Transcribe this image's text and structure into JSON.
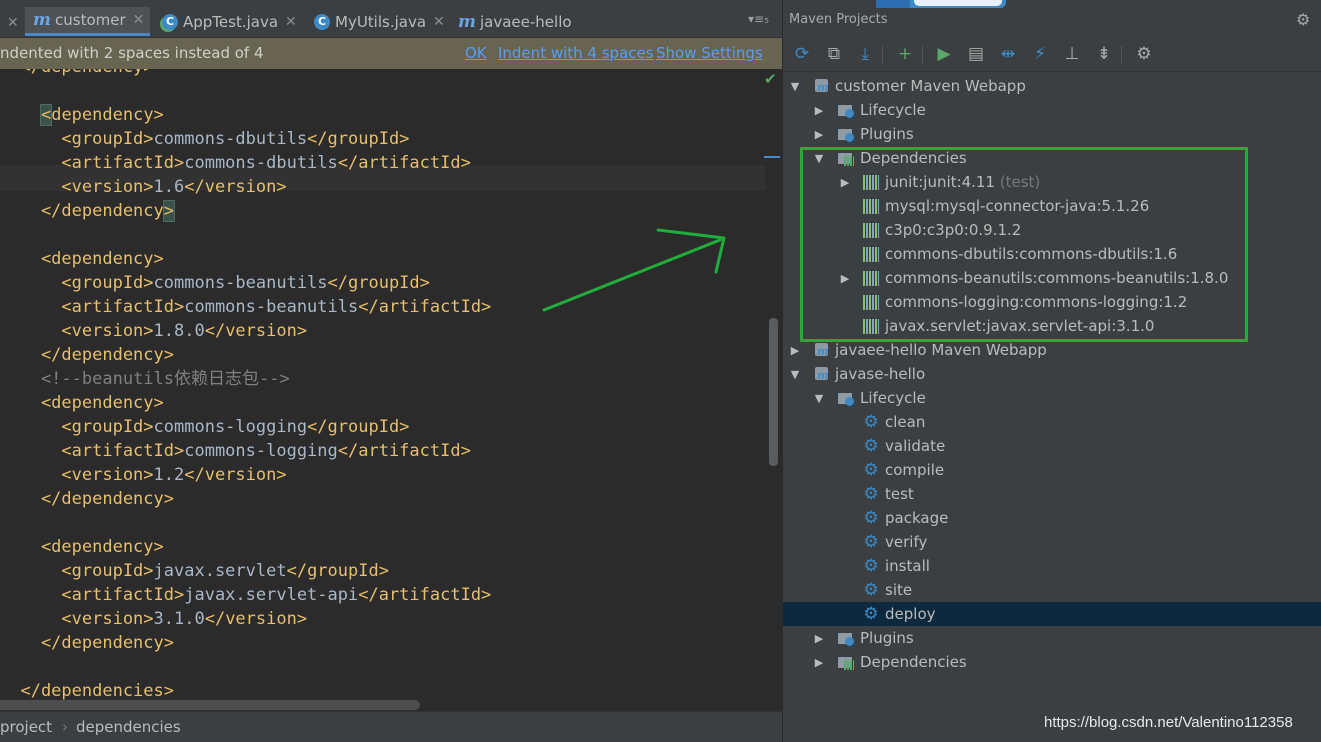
{
  "editor": {
    "tabs": [
      {
        "icon": "m",
        "label": "customer",
        "closable": true,
        "active": true
      },
      {
        "icon": "c",
        "label": "AppTest.java",
        "closable": true
      },
      {
        "icon": "c",
        "label": "MyUtils.java",
        "closable": true
      },
      {
        "icon": "m",
        "label": "javaee-hello",
        "closable": false
      }
    ],
    "tab_overflow": "▾≡₅",
    "notice": {
      "message": "ndented with 2 spaces instead of 4",
      "ok": "OK",
      "indent": "Indent with 4 spaces",
      "settings": "Show Settings"
    },
    "code_lines": [
      {
        "parts": [
          {
            "t": "  </dependency>",
            "c": "tg"
          }
        ]
      },
      {
        "parts": []
      },
      {
        "parts": [
          {
            "t": "    ",
            "c": "tx"
          },
          {
            "t": "<",
            "c": "tg hl"
          },
          {
            "t": "dependency>",
            "c": "tg"
          }
        ]
      },
      {
        "parts": [
          {
            "t": "      <groupId>",
            "c": "tg"
          },
          {
            "t": "commons-dbutils",
            "c": "tx"
          },
          {
            "t": "</groupId>",
            "c": "tg"
          }
        ]
      },
      {
        "parts": [
          {
            "t": "      <artifactId>",
            "c": "tg"
          },
          {
            "t": "commons-dbutils",
            "c": "tx"
          },
          {
            "t": "</artifactId>",
            "c": "tg"
          }
        ]
      },
      {
        "parts": [
          {
            "t": "      <version>",
            "c": "tg"
          },
          {
            "t": "1.6",
            "c": "tx"
          },
          {
            "t": "</version>",
            "c": "tg"
          }
        ]
      },
      {
        "parts": [
          {
            "t": "    </dependency",
            "c": "tg"
          },
          {
            "t": ">",
            "c": "tg hl"
          }
        ]
      },
      {
        "parts": []
      },
      {
        "parts": [
          {
            "t": "    <dependency>",
            "c": "tg"
          }
        ]
      },
      {
        "parts": [
          {
            "t": "      <groupId>",
            "c": "tg"
          },
          {
            "t": "commons-beanutils",
            "c": "tx"
          },
          {
            "t": "</groupId>",
            "c": "tg"
          }
        ]
      },
      {
        "parts": [
          {
            "t": "      <artifactId>",
            "c": "tg"
          },
          {
            "t": "commons-beanutils",
            "c": "tx"
          },
          {
            "t": "</artifactId>",
            "c": "tg"
          }
        ]
      },
      {
        "parts": [
          {
            "t": "      <version>",
            "c": "tg"
          },
          {
            "t": "1.8.0",
            "c": "tx"
          },
          {
            "t": "</version>",
            "c": "tg"
          }
        ]
      },
      {
        "parts": [
          {
            "t": "    </dependency>",
            "c": "tg"
          }
        ]
      },
      {
        "parts": [
          {
            "t": "    <!--",
            "c": "cm"
          },
          {
            "t": "beanutils",
            "c": "cm sq"
          },
          {
            "t": "依赖日志包-->",
            "c": "cm"
          }
        ]
      },
      {
        "parts": [
          {
            "t": "    <dependency>",
            "c": "tg"
          }
        ]
      },
      {
        "parts": [
          {
            "t": "      <groupId>",
            "c": "tg"
          },
          {
            "t": "commons-logging",
            "c": "tx"
          },
          {
            "t": "</groupId>",
            "c": "tg"
          }
        ]
      },
      {
        "parts": [
          {
            "t": "      <artifactId>",
            "c": "tg"
          },
          {
            "t": "commons-logging",
            "c": "tx"
          },
          {
            "t": "</artifactId>",
            "c": "tg"
          }
        ]
      },
      {
        "parts": [
          {
            "t": "      <version>",
            "c": "tg"
          },
          {
            "t": "1.2",
            "c": "tx"
          },
          {
            "t": "</version>",
            "c": "tg"
          }
        ]
      },
      {
        "parts": [
          {
            "t": "    </dependency>",
            "c": "tg"
          }
        ]
      },
      {
        "parts": []
      },
      {
        "parts": [
          {
            "t": "    <dependency>",
            "c": "tg"
          }
        ]
      },
      {
        "parts": [
          {
            "t": "      <groupId>",
            "c": "tg"
          },
          {
            "t": "javax.servlet",
            "c": "tx"
          },
          {
            "t": "</groupId>",
            "c": "tg"
          }
        ]
      },
      {
        "parts": [
          {
            "t": "      <artifactId>",
            "c": "tg"
          },
          {
            "t": "javax.servlet-api",
            "c": "tx"
          },
          {
            "t": "</artifactId>",
            "c": "tg"
          }
        ]
      },
      {
        "parts": [
          {
            "t": "      <version>",
            "c": "tg"
          },
          {
            "t": "3.1.0",
            "c": "tx"
          },
          {
            "t": "</version>",
            "c": "tg"
          }
        ]
      },
      {
        "parts": [
          {
            "t": "    </dependency>",
            "c": "tg"
          }
        ]
      },
      {
        "parts": []
      },
      {
        "parts": [
          {
            "t": "  </dependencies>",
            "c": "tg"
          }
        ]
      }
    ],
    "breadcrumb": {
      "item1": "project",
      "separator": "›",
      "item2": "dependencies"
    }
  },
  "maven": {
    "title": "Maven Projects",
    "toolbar": [
      {
        "name": "reimport-icon",
        "glyph": "⟳",
        "color": "blue"
      },
      {
        "name": "generate-sources-icon",
        "glyph": "⧉",
        "color": "grey"
      },
      {
        "name": "download-icon",
        "glyph": "⤓",
        "color": "blue"
      },
      {
        "name": "add-icon",
        "glyph": "+",
        "color": "green"
      },
      {
        "name": "run-icon",
        "glyph": "▶",
        "color": "green"
      },
      {
        "name": "run-config-icon",
        "glyph": "▤",
        "color": "grey"
      },
      {
        "name": "toggle-offline-icon",
        "glyph": "⇹",
        "color": "blue"
      },
      {
        "name": "skip-tests-icon",
        "glyph": "⚡",
        "color": "blue"
      },
      {
        "name": "show-dependencies-icon",
        "glyph": "⊥",
        "color": "grey"
      },
      {
        "name": "collapse-all-icon",
        "glyph": "⇟",
        "color": "grey"
      },
      {
        "name": "settings-icon",
        "glyph": "⚙",
        "color": "grey"
      }
    ],
    "tree": [
      {
        "label": "customer Maven Webapp",
        "level": 0,
        "arrow": "open",
        "icon": "project"
      },
      {
        "label": "Lifecycle",
        "level": 1,
        "arrow": "closed",
        "icon": "folder-gear"
      },
      {
        "label": "Plugins",
        "level": 1,
        "arrow": "closed",
        "icon": "folder-gear"
      },
      {
        "label": "Dependencies",
        "level": 1,
        "arrow": "open",
        "icon": "folder-lib"
      },
      {
        "label": "junit:junit:4.11",
        "suffix": " (test)",
        "level": 2,
        "arrow": "closed",
        "icon": "lib"
      },
      {
        "label": "mysql:mysql-connector-java:5.1.26",
        "level": 2,
        "arrow": "none",
        "icon": "lib"
      },
      {
        "label": "c3p0:c3p0:0.9.1.2",
        "level": 2,
        "arrow": "none",
        "icon": "lib"
      },
      {
        "label": "commons-dbutils:commons-dbutils:1.6",
        "level": 2,
        "arrow": "none",
        "icon": "lib"
      },
      {
        "label": "commons-beanutils:commons-beanutils:1.8.0",
        "level": 2,
        "arrow": "closed",
        "icon": "lib"
      },
      {
        "label": "commons-logging:commons-logging:1.2",
        "level": 2,
        "arrow": "none",
        "icon": "lib"
      },
      {
        "label": "javax.servlet:javax.servlet-api:3.1.0",
        "level": 2,
        "arrow": "none",
        "icon": "lib"
      },
      {
        "label": "javaee-hello Maven Webapp",
        "level": 0,
        "arrow": "closed",
        "icon": "project"
      },
      {
        "label": "javase-hello",
        "level": 0,
        "arrow": "open",
        "icon": "project"
      },
      {
        "label": "Lifecycle",
        "level": 1,
        "arrow": "open",
        "icon": "folder-gear"
      },
      {
        "label": "clean",
        "level": 2,
        "arrow": "none",
        "icon": "gear"
      },
      {
        "label": "validate",
        "level": 2,
        "arrow": "none",
        "icon": "gear"
      },
      {
        "label": "compile",
        "level": 2,
        "arrow": "none",
        "icon": "gear"
      },
      {
        "label": "test",
        "level": 2,
        "arrow": "none",
        "icon": "gear"
      },
      {
        "label": "package",
        "level": 2,
        "arrow": "none",
        "icon": "gear"
      },
      {
        "label": "verify",
        "level": 2,
        "arrow": "none",
        "icon": "gear"
      },
      {
        "label": "install",
        "level": 2,
        "arrow": "none",
        "icon": "gear"
      },
      {
        "label": "site",
        "level": 2,
        "arrow": "none",
        "icon": "gear"
      },
      {
        "label": "deploy",
        "level": 2,
        "arrow": "none",
        "icon": "gear",
        "selected": true
      },
      {
        "label": "Plugins",
        "level": 1,
        "arrow": "closed",
        "icon": "folder-gear"
      },
      {
        "label": "Dependencies",
        "level": 1,
        "arrow": "closed",
        "icon": "folder-lib"
      }
    ]
  },
  "annotation": {
    "color": "#1fae3c"
  },
  "watermark": "https://blog.csdn.net/Valentino112358",
  "colors": {
    "accent": "#4a88c7",
    "tag": "#e8bf6a",
    "selection": "#0d293e"
  }
}
